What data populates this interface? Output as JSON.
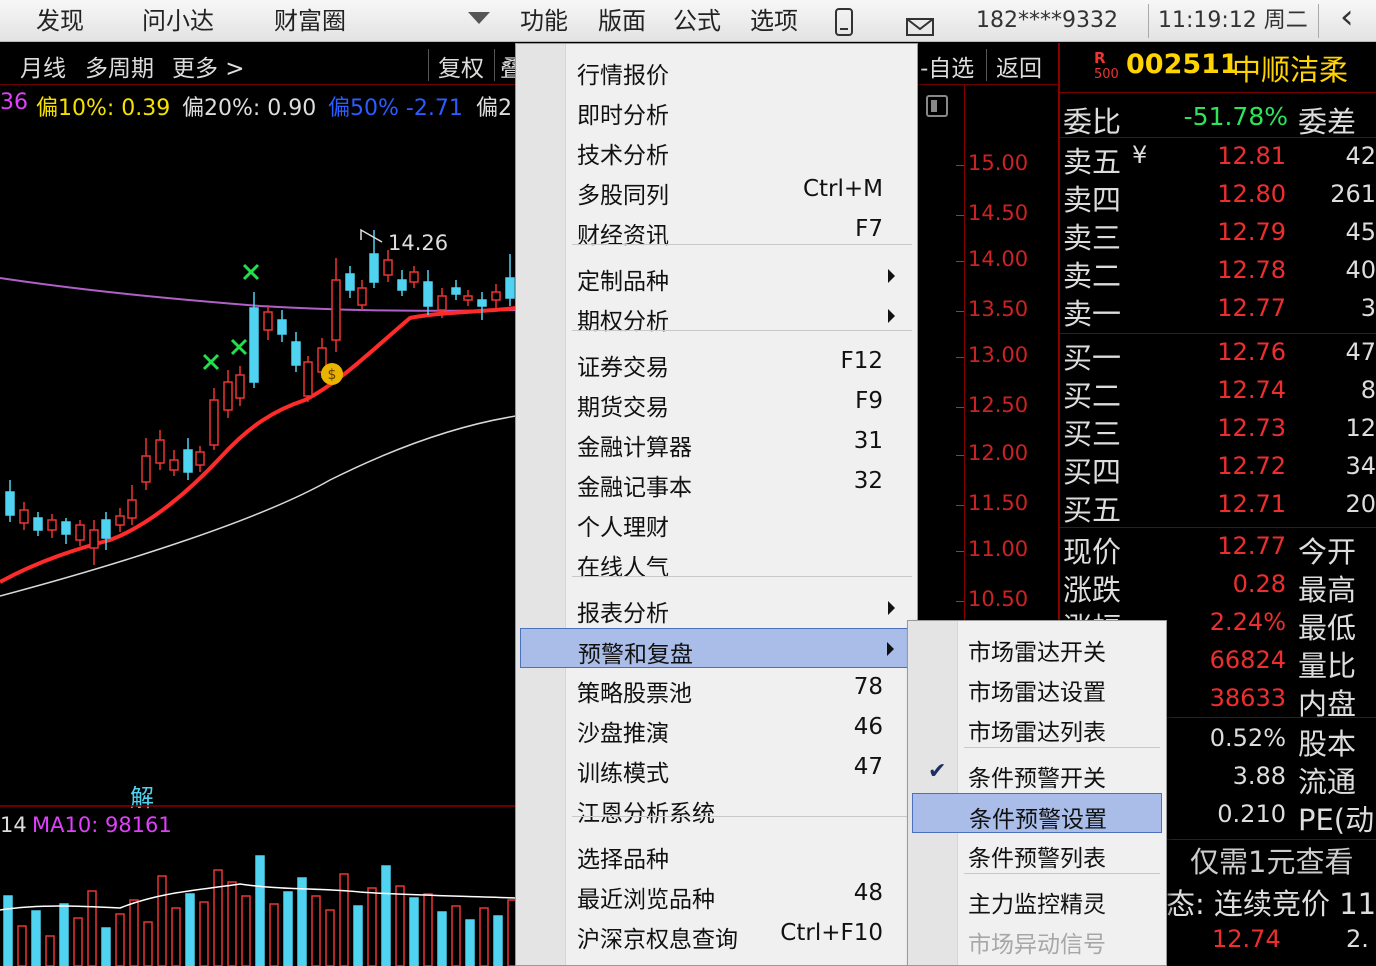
{
  "topbar": {
    "discover": "发现",
    "ask": "问小达",
    "wealth": "财富圈",
    "function": "功能",
    "layout": "版面",
    "formula": "公式",
    "options": "选项",
    "account": "182****9332",
    "clock": "11:19:12 周二",
    "back_arrow": "‹"
  },
  "chart": {
    "toolbar": {
      "monthly": "月线",
      "multi_period": "多周期",
      "more": "更多 >",
      "adjust": "复权",
      "partial": "叠",
      "watchlist": "-自选",
      "back": "返回"
    },
    "indicators": {
      "prefix": "36",
      "dev10": "偏10%: 0.39",
      "dev20": "偏20%: 0.90",
      "dev50": "偏50% -2.71",
      "dev_more": "偏2"
    },
    "high_label": "14.26",
    "solve_label": "解",
    "volume": {
      "prefix": "14",
      "ma10": "MA10: 98161"
    },
    "price_axis": [
      "15.00",
      "14.50",
      "14.00",
      "13.50",
      "13.00",
      "12.50",
      "12.00",
      "11.50",
      "11.00",
      "10.50"
    ]
  },
  "quote": {
    "r_badge": "R",
    "r_500": "500",
    "code": "002511",
    "name": "中顺洁柔",
    "ratio": {
      "label": "委比",
      "value": "-51.78%",
      "right": "委差"
    },
    "sells": [
      {
        "label": "卖五",
        "price": "12.81",
        "vol": "42"
      },
      {
        "label": "卖四",
        "price": "12.80",
        "vol": "261"
      },
      {
        "label": "卖三",
        "price": "12.79",
        "vol": "45"
      },
      {
        "label": "卖二",
        "price": "12.78",
        "vol": "40"
      },
      {
        "label": "卖一",
        "price": "12.77",
        "vol": "3"
      }
    ],
    "sell_currency": "¥",
    "buys": [
      {
        "label": "买一",
        "price": "12.76",
        "vol": "47"
      },
      {
        "label": "买二",
        "price": "12.74",
        "vol": "8"
      },
      {
        "label": "买三",
        "price": "12.73",
        "vol": "12"
      },
      {
        "label": "买四",
        "price": "12.72",
        "vol": "34"
      },
      {
        "label": "买五",
        "price": "12.71",
        "vol": "20"
      }
    ],
    "stats": [
      {
        "label": "现价",
        "value": "12.77",
        "right": "今开"
      },
      {
        "label": "涨跌",
        "value": "0.28",
        "right": "最高"
      },
      {
        "label": "涨幅",
        "value": "2.24%",
        "right": "最低"
      },
      {
        "label": "",
        "value": "66824",
        "right": "量比"
      },
      {
        "label": "",
        "value": "38633",
        "right": "内盘"
      }
    ],
    "extra": [
      {
        "value": "0.52%",
        "right": "股本"
      },
      {
        "value": "3.88",
        "right": "流通"
      },
      {
        "value": "0.210",
        "right": "PE(动"
      }
    ],
    "promo": "仅需1元查看",
    "status": "态: 连续竞价 11",
    "bottom_price": "12.74",
    "bottom_right": "2."
  },
  "menu": {
    "items": [
      {
        "label": "行情报价",
        "shortcut": ""
      },
      {
        "label": "即时分析",
        "shortcut": ""
      },
      {
        "label": "技术分析",
        "shortcut": ""
      },
      {
        "label": "多股同列",
        "shortcut": "Ctrl+M"
      },
      {
        "label": "财经资讯",
        "shortcut": "F7"
      },
      {
        "label": "定制品种",
        "shortcut": ""
      },
      {
        "label": "期权分析",
        "shortcut": ""
      },
      {
        "label": "证券交易",
        "shortcut": "F12"
      },
      {
        "label": "期货交易",
        "shortcut": "F9"
      },
      {
        "label": "金融计算器",
        "shortcut": "31"
      },
      {
        "label": "金融记事本",
        "shortcut": "32"
      },
      {
        "label": "个人理财",
        "shortcut": ""
      },
      {
        "label": "在线人气",
        "shortcut": ""
      },
      {
        "label": "报表分析",
        "shortcut": ""
      },
      {
        "label": "预警和复盘",
        "shortcut": ""
      },
      {
        "label": "策略股票池",
        "shortcut": "78"
      },
      {
        "label": "沙盘推演",
        "shortcut": "46"
      },
      {
        "label": "训练模式",
        "shortcut": "47"
      },
      {
        "label": "江恩分析系统",
        "shortcut": ""
      },
      {
        "label": "选择品种",
        "shortcut": ""
      },
      {
        "label": "最近浏览品种",
        "shortcut": "48"
      },
      {
        "label": "沪深京权息查询",
        "shortcut": "Ctrl+F10"
      }
    ]
  },
  "submenu": {
    "items": [
      {
        "label": "市场雷达开关"
      },
      {
        "label": "市场雷达设置"
      },
      {
        "label": "市场雷达列表"
      },
      {
        "label": "条件预警开关"
      },
      {
        "label": "条件预警设置"
      },
      {
        "label": "条件预警列表"
      },
      {
        "label": "主力监控精灵"
      },
      {
        "label": "市场异动信号"
      }
    ]
  },
  "colors": {
    "up": "#e33",
    "down": "#4fd3f0",
    "ma_red": "#ff2a2a",
    "ma_purple": "#b060c8",
    "ma_white": "#d8d8d8",
    "highlight": "#a9bde8"
  }
}
